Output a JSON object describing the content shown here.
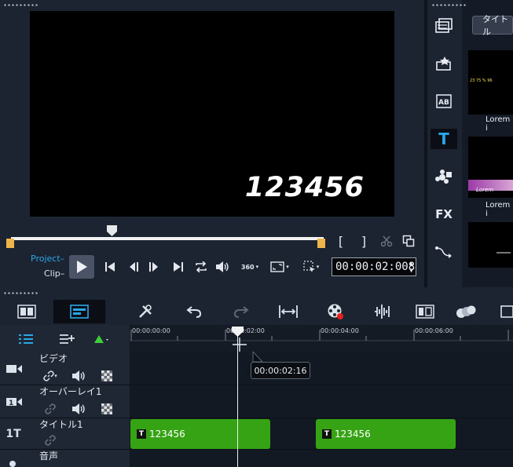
{
  "preview": {
    "overlay_text": "123456",
    "project_label": "Project",
    "clip_label": "Clip",
    "timecode": "00:00:02:008",
    "vr_label": "360",
    "mark_in": "[",
    "mark_out": "]"
  },
  "library": {
    "tab_label": "タイトル",
    "thumbnails": [
      {
        "label": "Lorem i",
        "overlay": "23  75  %  96"
      },
      {
        "label": "Lorem i",
        "overlay": "Lorem"
      },
      {
        "label": "",
        "overlay": ""
      }
    ],
    "sidebar_icons": [
      "media-icon",
      "instant-project-icon",
      "transition-icon",
      "title-icon",
      "graphics-icon",
      "fx-icon",
      "path-icon"
    ],
    "fx_label": "FX",
    "ab_label": "AB"
  },
  "toolbar": {
    "buttons": [
      "storyboard-view-icon",
      "timeline-view-icon",
      "tools-icon",
      "undo-icon",
      "redo-icon",
      "fit-timeline-icon",
      "record-capture-icon",
      "audio-mixer-icon",
      "auto-music-icon",
      "blend-icon",
      "more-icon"
    ]
  },
  "timeline": {
    "ruler_labels": [
      "00:00:00:00",
      "00:00:02:00",
      "00:00:04:00",
      "00:00:06:00"
    ],
    "tooltip": "00:00:02:16",
    "tracks": [
      {
        "name": "ビデオ"
      },
      {
        "name": "オーバーレイ1"
      },
      {
        "name": "タイトル1"
      },
      {
        "name": "音声"
      }
    ],
    "clips": [
      {
        "label": "123456",
        "type_badge": "T"
      },
      {
        "label": "123456",
        "type_badge": "T"
      }
    ],
    "title_track_prefix": "1T"
  },
  "colors": {
    "clip_green": "#35a313",
    "accent_blue": "#2aa7e8",
    "trim_orange": "#f0b54a"
  }
}
